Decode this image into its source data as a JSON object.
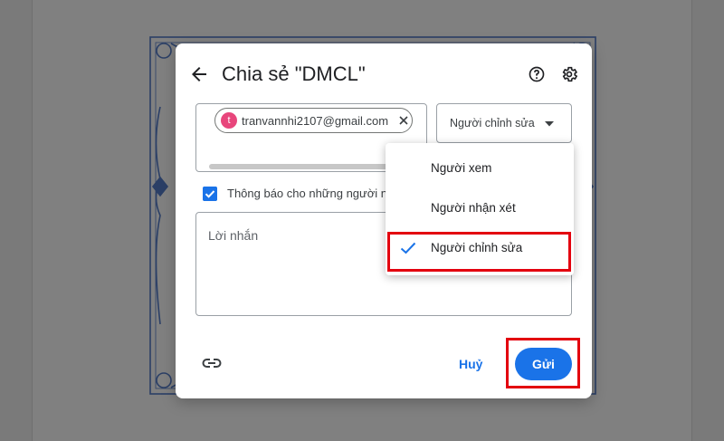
{
  "dialog": {
    "title": "Chia sẻ \"DMCL\"",
    "recipient": {
      "avatar_letter": "t",
      "email": "tranvannhi2107@gmail.com"
    },
    "role_select": {
      "selected": "Người chỉnh sửa"
    },
    "notify": {
      "checked": true,
      "label": "Thông báo cho những người nhận"
    },
    "message_placeholder": "Lời nhắn",
    "cancel_label": "Huỷ",
    "send_label": "Gửi"
  },
  "dropdown": {
    "items": [
      {
        "label": "Người xem",
        "selected": false
      },
      {
        "label": "Người nhận xét",
        "selected": false
      },
      {
        "label": "Người chỉnh sửa",
        "selected": true
      }
    ]
  },
  "colors": {
    "accent": "#1a73e8",
    "avatar": "#e8467c",
    "highlight": "#e3000f"
  },
  "icons": [
    "arrow-back-icon",
    "help-icon",
    "gear-icon",
    "close-icon",
    "dropdown-caret-icon",
    "checkmark-icon",
    "link-icon"
  ]
}
